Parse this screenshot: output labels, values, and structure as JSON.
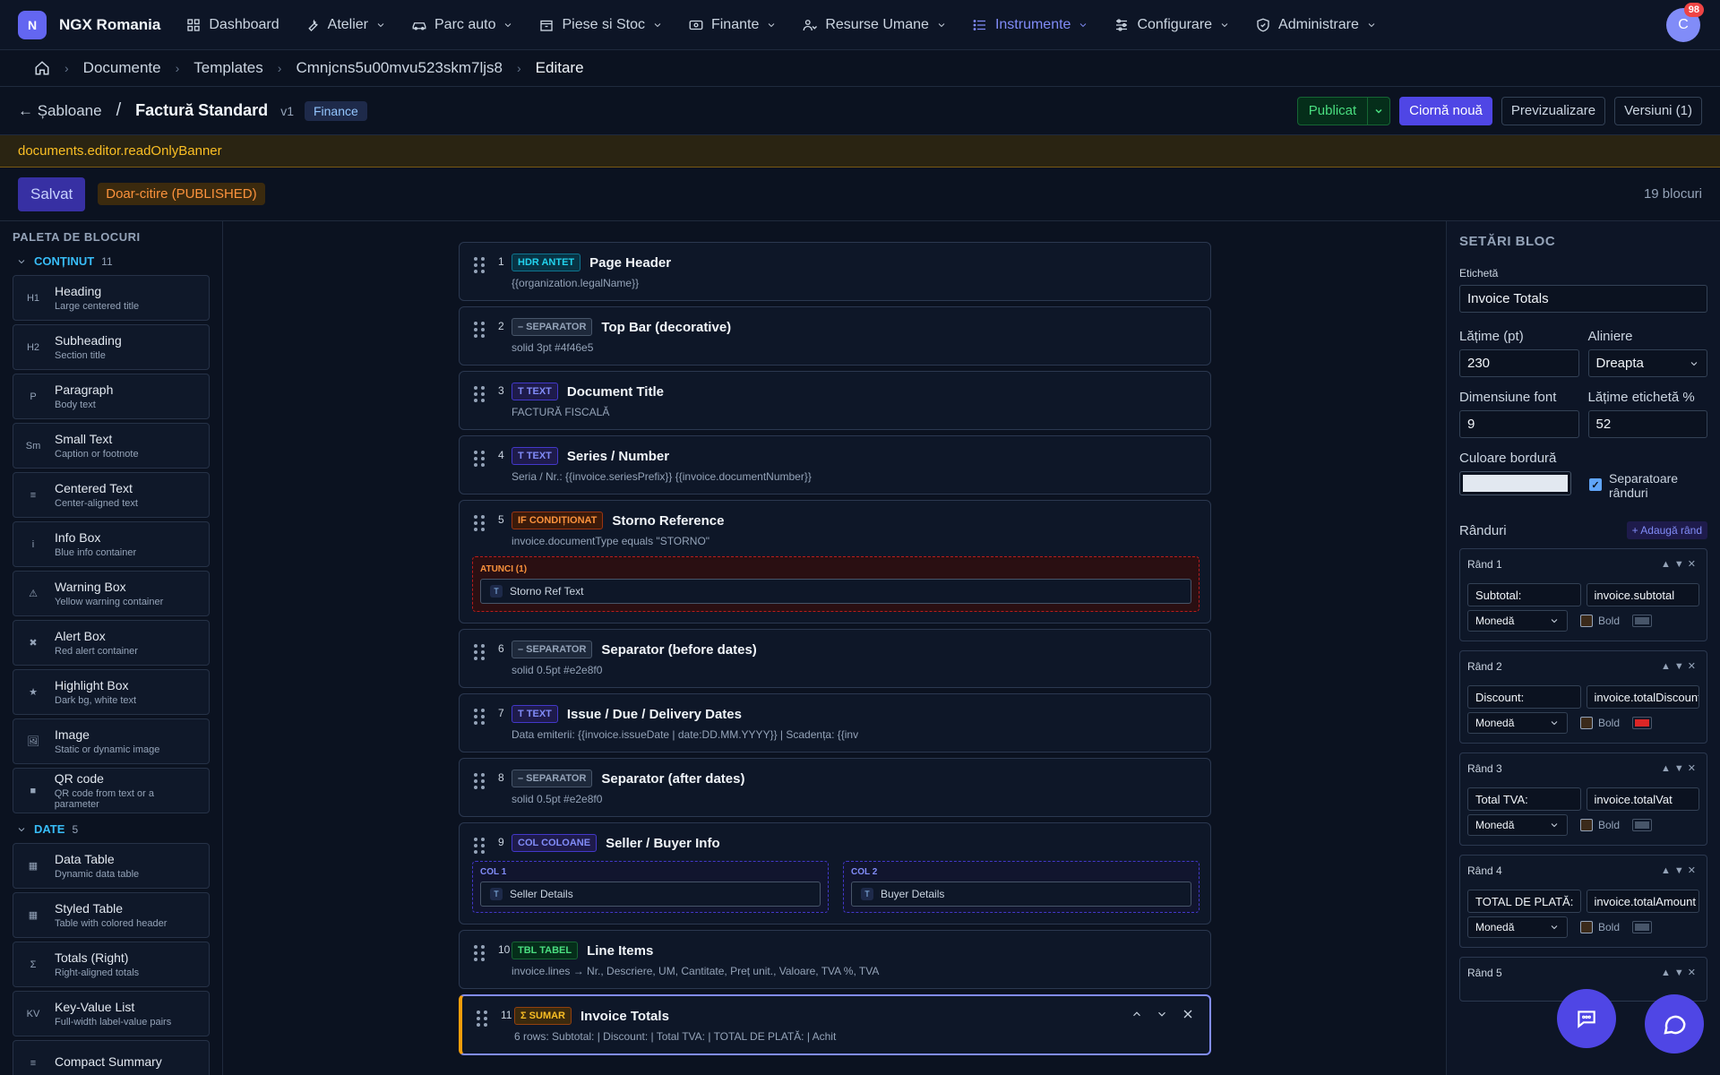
{
  "app": {
    "logo": "N",
    "brand": "NGX Romania"
  },
  "nav": [
    {
      "label": "Dashboard",
      "icon": "grid-icon",
      "dropdown": false
    },
    {
      "label": "Atelier",
      "icon": "wrench-icon",
      "dropdown": true
    },
    {
      "label": "Parc auto",
      "icon": "car-icon",
      "dropdown": true
    },
    {
      "label": "Piese si Stoc",
      "icon": "box-icon",
      "dropdown": true
    },
    {
      "label": "Finante",
      "icon": "cash-icon",
      "dropdown": true
    },
    {
      "label": "Resurse Umane",
      "icon": "users-icon",
      "dropdown": true
    },
    {
      "label": "Instrumente",
      "icon": "list-icon",
      "dropdown": true,
      "active": true
    },
    {
      "label": "Configurare",
      "icon": "sliders-icon",
      "dropdown": true
    },
    {
      "label": "Administrare",
      "icon": "shield-icon",
      "dropdown": true
    }
  ],
  "user": {
    "initial": "C",
    "notifications": "98"
  },
  "breadcrumb": [
    "Documente",
    "Templates",
    "Cmnjcns5u00mvu523skm7ljs8",
    "Editare"
  ],
  "titlebar": {
    "back": "← Șabloane",
    "slash": "/",
    "title": "Factură Standard",
    "version": "v1",
    "tag": "Finance",
    "publish": "Publicat",
    "new_draft": "Ciornă nouă",
    "preview": "Previzualizare",
    "versions": "Versiuni (1)"
  },
  "banner": "documents.editor.readOnlyBanner",
  "savebar": {
    "save": "Salvat",
    "readonly": "Doar-citire (PUBLISHED)",
    "count": "19 blocuri"
  },
  "palette": {
    "title": "PALETA DE BLOCURI",
    "sections": [
      {
        "name": "CONȚINUT",
        "count": "11",
        "items": [
          {
            "icon": "H1",
            "title": "Heading",
            "desc": "Large centered title"
          },
          {
            "icon": "H2",
            "title": "Subheading",
            "desc": "Section title"
          },
          {
            "icon": "P",
            "title": "Paragraph",
            "desc": "Body text"
          },
          {
            "icon": "Sm",
            "title": "Small Text",
            "desc": "Caption or footnote"
          },
          {
            "icon": "≡",
            "title": "Centered Text",
            "desc": "Center-aligned text"
          },
          {
            "icon": "i",
            "title": "Info Box",
            "desc": "Blue info container"
          },
          {
            "icon": "⚠",
            "title": "Warning Box",
            "desc": "Yellow warning container"
          },
          {
            "icon": "✖",
            "title": "Alert Box",
            "desc": "Red alert container"
          },
          {
            "icon": "★",
            "title": "Highlight Box",
            "desc": "Dark bg, white text"
          },
          {
            "icon": "🖼",
            "title": "Image",
            "desc": "Static or dynamic image"
          },
          {
            "icon": "■",
            "title": "QR code",
            "desc": "QR code from text or a parameter"
          }
        ]
      },
      {
        "name": "DATE",
        "count": "5",
        "items": [
          {
            "icon": "▦",
            "title": "Data Table",
            "desc": "Dynamic data table"
          },
          {
            "icon": "▦",
            "title": "Styled Table",
            "desc": "Table with colored header"
          },
          {
            "icon": "Σ",
            "title": "Totals (Right)",
            "desc": "Right-aligned totals"
          },
          {
            "icon": "KV",
            "title": "Key-Value List",
            "desc": "Full-width label-value pairs"
          },
          {
            "icon": "≡",
            "title": "Compact Summary",
            "desc": ""
          }
        ]
      }
    ]
  },
  "blocks": [
    {
      "num": "1",
      "tag": "HDR ANTET",
      "cls": "t-hdr",
      "title": "Page Header",
      "sub": "{{organization.legalName}}"
    },
    {
      "num": "2",
      "tag": "– SEPARATOR",
      "cls": "t-sep",
      "title": "Top Bar (decorative)",
      "sub": "solid 3pt #4f46e5"
    },
    {
      "num": "3",
      "tag": "T TEXT",
      "cls": "t-text",
      "title": "Document Title",
      "sub": "FACTURĂ FISCALĂ"
    },
    {
      "num": "4",
      "tag": "T TEXT",
      "cls": "t-text",
      "title": "Series / Number",
      "sub": "Seria / Nr.: {{invoice.seriesPrefix}} {{invoice.documentNumber}}"
    },
    {
      "num": "5",
      "tag": "IF CONDIȚIONAT",
      "cls": "t-if",
      "title": "Storno Reference",
      "sub": "invoice.documentType equals \"STORNO\"",
      "then_label": "ATUNCI (1)",
      "then_child": "Storno Ref Text"
    },
    {
      "num": "6",
      "tag": "– SEPARATOR",
      "cls": "t-sep",
      "title": "Separator (before dates)",
      "sub": "solid 0.5pt #e2e8f0"
    },
    {
      "num": "7",
      "tag": "T TEXT",
      "cls": "t-text",
      "title": "Issue / Due / Delivery Dates",
      "sub": "Data emiterii: {{invoice.issueDate | date:DD.MM.YYYY}} | Scadența: {{inv"
    },
    {
      "num": "8",
      "tag": "– SEPARATOR",
      "cls": "t-sep",
      "title": "Separator (after dates)",
      "sub": "solid 0.5pt #e2e8f0"
    },
    {
      "num": "9",
      "tag": "COL COLOANE",
      "cls": "t-col",
      "title": "Seller / Buyer Info",
      "sub": "",
      "col1_label": "COL 1",
      "col1_child": "Seller Details",
      "col2_label": "COL 2",
      "col2_child": "Buyer Details"
    },
    {
      "num": "10",
      "tag": "TBL TABEL",
      "cls": "t-tbl",
      "title": "Line Items",
      "sub": "invoice.lines → Nr., Descriere, UM, Cantitate, Preț unit., Valoare, TVA %, TVA"
    },
    {
      "num": "11",
      "tag": "Σ SUMAR",
      "cls": "t-sum",
      "title": "Invoice Totals",
      "sub": "6 rows: Subtotal: | Discount: | Total TVA: | TOTAL DE PLATĂ: | Achit"
    }
  ],
  "settings": {
    "title": "SETĂRI BLOC",
    "label_lbl": "Etichetă",
    "label_val": "Invoice Totals",
    "width_lbl": "Lățime (pt)",
    "width_val": "230",
    "align_lbl": "Aliniere",
    "align_val": "Dreapta",
    "font_lbl": "Dimensiune font",
    "font_val": "9",
    "lblw_lbl": "Lățime etichetă %",
    "lblw_val": "52",
    "border_lbl": "Culoare bordură",
    "border_color": "#e2e8f0",
    "sep_lbl": "Separatoare rânduri",
    "rows_lbl": "Rânduri",
    "add_row": "+ Adaugă rând",
    "rows": [
      {
        "title": "Rând 1",
        "label": "Subtotal:",
        "field": "invoice.subtotal",
        "format": "Monedă",
        "bold": "Bold",
        "color": "#475569"
      },
      {
        "title": "Rând 2",
        "label": "Discount:",
        "field": "invoice.totalDiscount",
        "format": "Monedă",
        "bold": "Bold",
        "color": "#dc2626"
      },
      {
        "title": "Rând 3",
        "label": "Total TVA:",
        "field": "invoice.totalVat",
        "format": "Monedă",
        "bold": "Bold",
        "color": "#475569"
      },
      {
        "title": "Rând 4",
        "label": "TOTAL DE PLATĂ:",
        "field": "invoice.totalAmount",
        "format": "Monedă",
        "bold": "Bold",
        "color": "#475569"
      },
      {
        "title": "Rând 5",
        "label": "",
        "field": "",
        "format": "",
        "bold": "",
        "color": ""
      }
    ]
  }
}
